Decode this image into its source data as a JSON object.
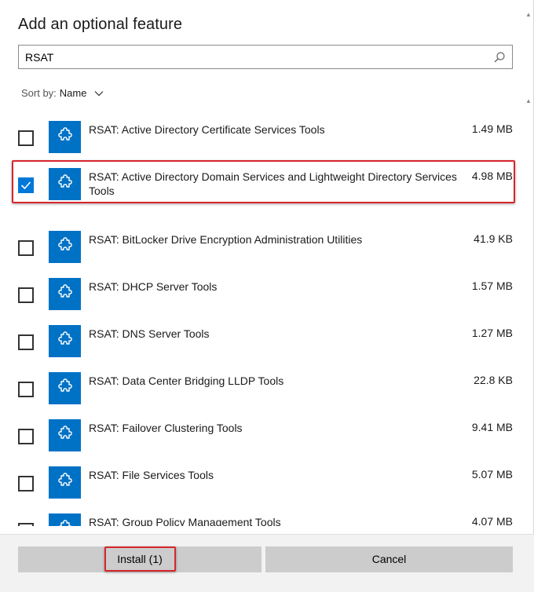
{
  "dialog": {
    "title": "Add an optional feature"
  },
  "search": {
    "value": "RSAT",
    "icon": "search-icon"
  },
  "sort": {
    "label": "Sort by:",
    "value": "Name"
  },
  "features": [
    {
      "name": "RSAT: Active Directory Certificate Services Tools",
      "size": "1.49 MB",
      "checked": false
    },
    {
      "name": "RSAT: Active Directory Domain Services and Lightweight Directory Services Tools",
      "size": "4.98 MB",
      "checked": true
    },
    {
      "name": "RSAT: BitLocker Drive Encryption Administration Utilities",
      "size": "41.9 KB",
      "checked": false
    },
    {
      "name": "RSAT: DHCP Server Tools",
      "size": "1.57 MB",
      "checked": false
    },
    {
      "name": "RSAT: DNS Server Tools",
      "size": "1.27 MB",
      "checked": false
    },
    {
      "name": "RSAT: Data Center Bridging LLDP Tools",
      "size": "22.8 KB",
      "checked": false
    },
    {
      "name": "RSAT: Failover Clustering Tools",
      "size": "9.41 MB",
      "checked": false
    },
    {
      "name": "RSAT: File Services Tools",
      "size": "5.07 MB",
      "checked": false
    },
    {
      "name": "RSAT: Group Policy Management Tools",
      "size": "4.07 MB",
      "checked": false
    }
  ],
  "buttons": {
    "install": "Install (1)",
    "cancel": "Cancel"
  },
  "colors": {
    "accent": "#0078d7",
    "icon_tile": "#0072c6",
    "highlight": "#d6262b",
    "button": "#cccccc"
  }
}
